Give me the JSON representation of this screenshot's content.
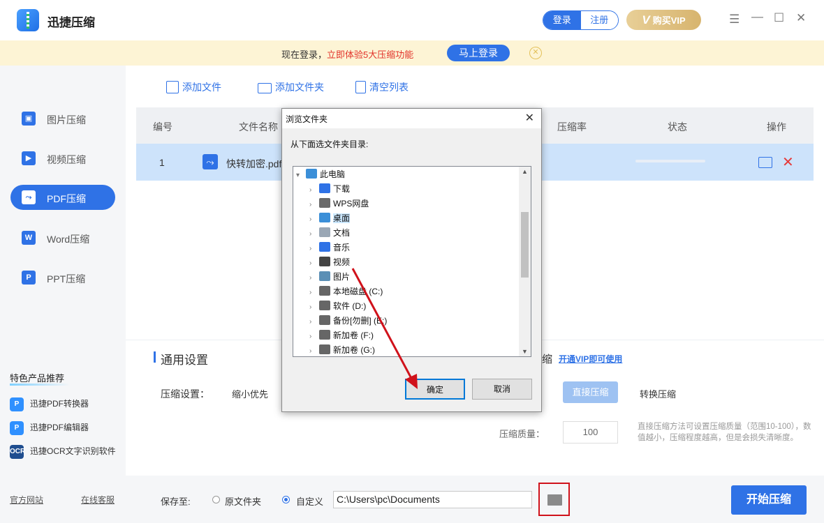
{
  "app": {
    "title": "迅捷压缩"
  },
  "header": {
    "login": "登录",
    "register": "注册",
    "vip_prefix": "V",
    "vip": "购买VIP"
  },
  "banner": {
    "text_prefix": "现在登录，",
    "text_highlight": "立即体验5大压缩功能",
    "button": "马上登录"
  },
  "sidebar": {
    "items": [
      {
        "label": "图片压缩",
        "icon": "image-compress-icon",
        "glyph": "▣"
      },
      {
        "label": "视频压缩",
        "icon": "video-compress-icon",
        "glyph": "▶"
      },
      {
        "label": "PDF压缩",
        "icon": "pdf-compress-icon",
        "glyph": "⤳",
        "active": true
      },
      {
        "label": "Word压缩",
        "icon": "word-compress-icon",
        "glyph": "W"
      },
      {
        "label": "PPT压缩",
        "icon": "ppt-compress-icon",
        "glyph": "P"
      }
    ],
    "recommend_title": "特色产品推荐",
    "recommend": [
      {
        "label": "迅捷PDF转换器",
        "glyph": "P"
      },
      {
        "label": "迅捷PDF编辑器",
        "glyph": "P"
      },
      {
        "label": "迅捷OCR文字识别软件",
        "glyph": "OCR"
      }
    ],
    "links": {
      "website": "官方网站",
      "support": "在线客服"
    }
  },
  "toolbar": {
    "add_file": "添加文件",
    "add_folder": "添加文件夹",
    "clear_list": "清空列表"
  },
  "table": {
    "headers": {
      "no": "编号",
      "name": "文件名称",
      "ratio": "压缩率",
      "status": "状态",
      "action": "操作"
    },
    "rows": [
      {
        "no": "1",
        "name": "快转加密.pdf"
      }
    ]
  },
  "settings": {
    "title": "通用设置",
    "title_suffix": "缩",
    "vip_link": "开通VIP即可使用",
    "compress_label": "压缩设置：",
    "compress_option": "缩小优先",
    "mode_direct": "直接压缩",
    "mode_convert": "转换压缩",
    "quality_label": "压缩质量：",
    "quality_value": "100",
    "note": "直接压缩方法可设置压缩质量（范围10-100），数值越小，压缩程度越高，但是会损失清晰度。"
  },
  "footer": {
    "save_to": "保存至:",
    "opt_original": "原文件夹",
    "opt_custom": "自定义",
    "path": "C:\\Users\\pc\\Documents",
    "start": "开始压缩"
  },
  "dialog": {
    "title": "浏览文件夹",
    "prompt": "从下面选文件夹目录:",
    "tree": [
      {
        "label": "此电脑",
        "icon": "computer-icon",
        "color": "#3b8fd8"
      },
      {
        "label": "下载",
        "icon": "download-icon",
        "color": "#2f72e6"
      },
      {
        "label": "WPS网盘",
        "icon": "cloud-icon",
        "color": "#6a6a6a"
      },
      {
        "label": "桌面",
        "icon": "desktop-icon",
        "color": "#3b8fd8",
        "selected": true
      },
      {
        "label": "文档",
        "icon": "document-icon",
        "color": "#9aa7b5"
      },
      {
        "label": "音乐",
        "icon": "music-icon",
        "color": "#2f72e6"
      },
      {
        "label": "视频",
        "icon": "video-icon",
        "color": "#444444"
      },
      {
        "label": "图片",
        "icon": "picture-icon",
        "color": "#5b8fb5"
      },
      {
        "label": "本地磁盘 (C:)",
        "icon": "drive-c-icon",
        "color": "#666666"
      },
      {
        "label": "软件 (D:)",
        "icon": "drive-d-icon",
        "color": "#666666"
      },
      {
        "label": "备份[勿删] (E:)",
        "icon": "drive-e-icon",
        "color": "#666666"
      },
      {
        "label": "新加卷 (F:)",
        "icon": "drive-f-icon",
        "color": "#666666"
      },
      {
        "label": "新加卷 (G:)",
        "icon": "drive-g-icon",
        "color": "#666666"
      }
    ],
    "ok": "确定",
    "cancel": "取消"
  },
  "colors": {
    "accent": "#2f72e6",
    "highlight_red": "#d0121b",
    "banner_bg": "#fdf4d5"
  }
}
